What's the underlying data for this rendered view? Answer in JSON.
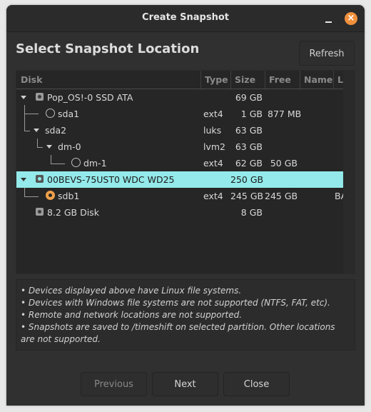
{
  "window": {
    "title": "Create Snapshot",
    "close_icon": "×",
    "accent_color": "#f0903c"
  },
  "header": {
    "heading": "Select Snapshot Location",
    "refresh_label": "Refresh"
  },
  "table": {
    "columns": [
      "Disk",
      "Type",
      "Size",
      "Free",
      "Name",
      "Lab"
    ],
    "rows": [
      {
        "name": "Pop_OS!-0 SSD ATA",
        "type": "",
        "size": "69 GB",
        "free": "",
        "label": "",
        "kind": "disk",
        "expanded": true
      },
      {
        "name": "sda1",
        "type": "ext4",
        "size": "1 GB",
        "free": "877 MB",
        "label": "",
        "kind": "partition",
        "selected": false
      },
      {
        "name": "sda2",
        "type": "luks",
        "size": "63 GB",
        "free": "",
        "label": "",
        "kind": "container",
        "expanded": true
      },
      {
        "name": "dm-0",
        "type": "lvm2",
        "size": "63 GB",
        "free": "",
        "label": "",
        "kind": "container",
        "expanded": true
      },
      {
        "name": "dm-1",
        "type": "ext4",
        "size": "62 GB",
        "free": "50 GB",
        "label": "",
        "kind": "partition",
        "selected": false
      },
      {
        "name": "00BEVS-75UST0 WDC WD25",
        "type": "",
        "size": "250 GB",
        "free": "",
        "label": "",
        "kind": "disk",
        "expanded": true,
        "highlighted": true
      },
      {
        "name": "sdb1",
        "type": "ext4",
        "size": "245 GB",
        "free": "245 GB",
        "label": "BACI",
        "kind": "partition",
        "selected": true
      },
      {
        "name": "8.2 GB Disk",
        "type": "",
        "size": "8 GB",
        "free": "",
        "label": "",
        "kind": "disk",
        "expanded": false
      }
    ],
    "highlight_color": "#94e9ea"
  },
  "info": {
    "lines": [
      "• Devices displayed above have Linux file systems.",
      "• Devices with Windows file systems are not supported (NTFS, FAT, etc).",
      "• Remote and network locations are not supported.",
      "• Snapshots are saved to /timeshift on selected partition. Other locations are not supported."
    ]
  },
  "footer": {
    "previous_label": "Previous",
    "next_label": "Next",
    "close_label": "Close"
  }
}
